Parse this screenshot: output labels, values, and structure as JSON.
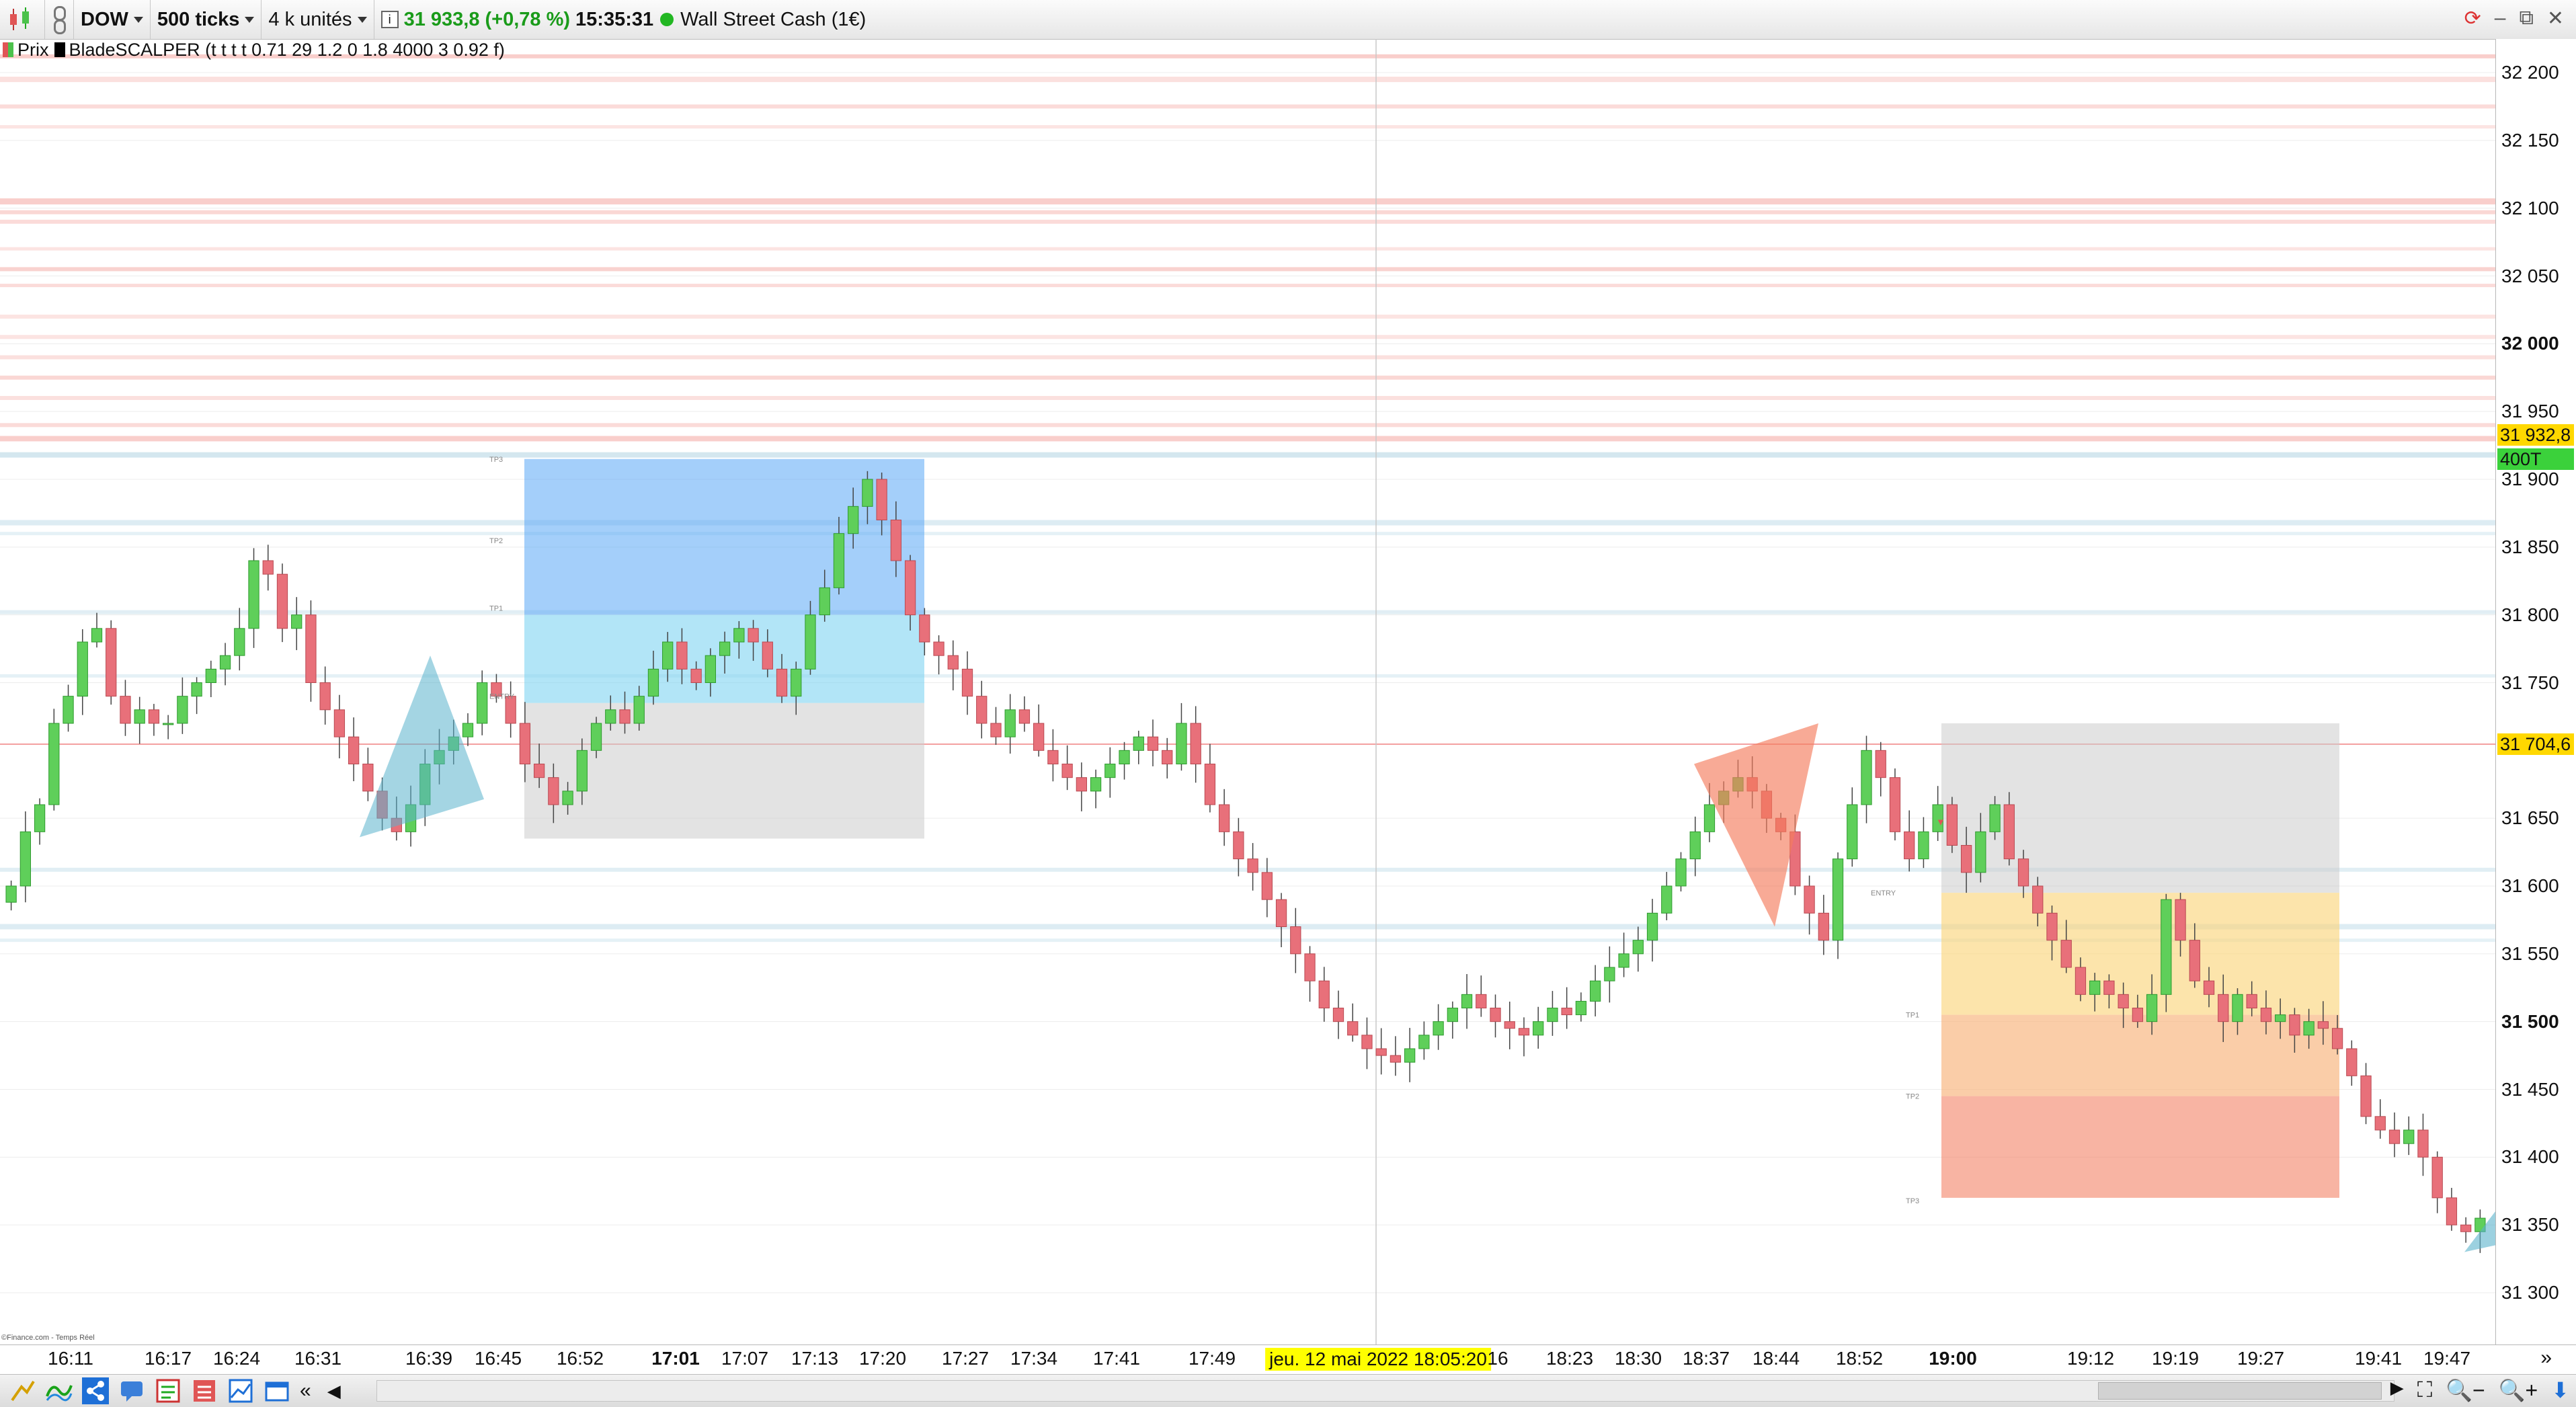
{
  "toolbar": {
    "symbol": "DOW",
    "interval": "500 ticks",
    "units": "4 k unités",
    "quote": "31 933,8 (+0,78 %)",
    "time": "15:35:31",
    "market": "Wall Street Cash (1€)"
  },
  "legend": {
    "price_label": "Prix",
    "indicator_label": "BladeSCALPER (t t t t 0.71 29 1.2 0 1.8 4000 3 0.92 f)"
  },
  "price_axis": {
    "labels": [
      "32 200",
      "32 150",
      "32 100",
      "32 050",
      "32 000",
      "31 950",
      "31 900",
      "31 850",
      "31 800",
      "31 750",
      "31 650",
      "31 600",
      "31 550",
      "31 500",
      "31 450",
      "31 400",
      "31 350",
      "31 300"
    ],
    "bold_labels": [
      "32 000",
      "31 500"
    ],
    "current_price_tag": "31 932,8",
    "tick_tag": "400T",
    "cursor_price_tag": "31 704,6"
  },
  "time_axis": {
    "labels": [
      "16:11",
      "16:17",
      "16:24",
      "16:31",
      "16:39",
      "16:45",
      "16:52",
      "17:01",
      "17:07",
      "17:13",
      "17:20",
      "17:27",
      "17:34",
      "17:41",
      "17:49",
      "16",
      "18:23",
      "18:30",
      "18:37",
      "18:44",
      "18:52",
      "19:00",
      "19:12",
      "19:19",
      "19:27",
      "19:41",
      "19:47"
    ],
    "bold_labels": [
      "17:01",
      "19:00"
    ],
    "cursor_date": "jeu. 12 mai 2022 18:05:20"
  },
  "chart_annotations": {
    "blue_zone": [
      "TP3",
      "TP2",
      "TP1",
      "ENTRY"
    ],
    "orange_zone": [
      "ENTRY",
      "TP1",
      "TP2",
      "TP3"
    ]
  },
  "copyright": "©Finance.com - Temps Réel",
  "colors": {
    "bull": "#5fcf5a",
    "bear": "#e8707a",
    "quote_green": "#1a9b1a",
    "cursor_yellow": "#ffff00",
    "current_tag": "#ffd800",
    "tick_tag": "#3bd13b"
  },
  "chart_data": {
    "type": "candlestick",
    "y_range": [
      31285,
      32220
    ],
    "candle_closes": [
      31600,
      31640,
      31660,
      31720,
      31740,
      31780,
      31790,
      31740,
      31720,
      31730,
      31720,
      31720,
      31740,
      31750,
      31760,
      31770,
      31790,
      31840,
      31830,
      31790,
      31800,
      31750,
      31730,
      31710,
      31690,
      31670,
      31650,
      31640,
      31660,
      31690,
      31700,
      31710,
      31720,
      31750,
      31740,
      31720,
      31690,
      31680,
      31660,
      31670,
      31700,
      31720,
      31730,
      31720,
      31740,
      31760,
      31780,
      31760,
      31750,
      31770,
      31780,
      31790,
      31780,
      31760,
      31740,
      31760,
      31800,
      31820,
      31860,
      31880,
      31900,
      31870,
      31840,
      31800,
      31780,
      31770,
      31760,
      31740,
      31720,
      31710,
      31730,
      31720,
      31700,
      31690,
      31680,
      31670,
      31680,
      31690,
      31700,
      31710,
      31700,
      31690,
      31720,
      31690,
      31660,
      31640,
      31620,
      31610,
      31590,
      31570,
      31550,
      31530,
      31510,
      31500,
      31490,
      31480,
      31475,
      31470,
      31480,
      31490,
      31500,
      31510,
      31520,
      31510,
      31500,
      31495,
      31490,
      31500,
      31510,
      31505,
      31515,
      31530,
      31540,
      31550,
      31560,
      31580,
      31600,
      31620,
      31640,
      31660,
      31670,
      31680,
      31670,
      31650,
      31640,
      31600,
      31580,
      31560,
      31620,
      31660,
      31700,
      31680,
      31640,
      31620,
      31640,
      31660,
      31630,
      31610,
      31640,
      31660,
      31620,
      31600,
      31580,
      31560,
      31540,
      31520,
      31530,
      31520,
      31510,
      31500,
      31520,
      31590,
      31560,
      31530,
      31520,
      31500,
      31520,
      31510,
      31500,
      31505,
      31490,
      31500,
      31495,
      31480,
      31460,
      31430,
      31420,
      31410,
      31420,
      31400,
      31370,
      31350,
      31345,
      31355
    ],
    "levels": [
      31704.6,
      31932.8
    ]
  }
}
